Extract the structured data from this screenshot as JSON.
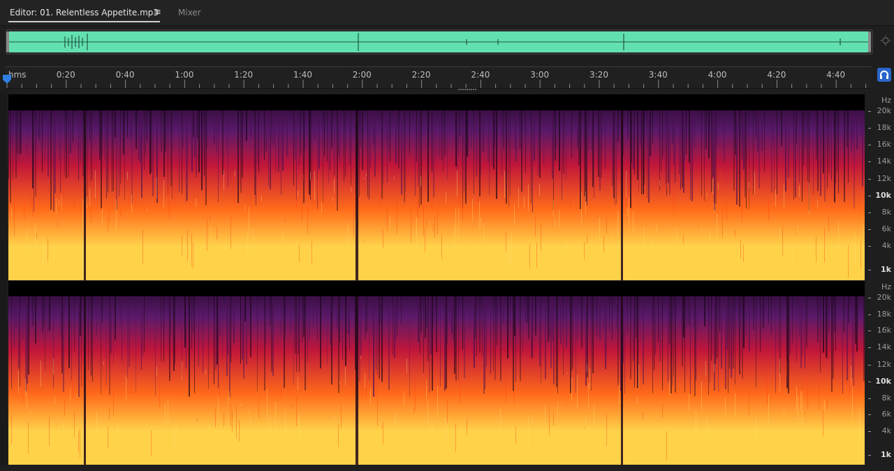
{
  "tabs": {
    "editor_label": "Editor: 01. Relentless Appetite.mp3",
    "menu_glyph": "≡",
    "mixer_label": "Mixer"
  },
  "ruler": {
    "format": "hms",
    "ticks": [
      "0:20",
      "0:40",
      "1:00",
      "1:20",
      "1:40",
      "2:00",
      "2:20",
      "2:40",
      "3:00",
      "3:20",
      "3:40",
      "4:00",
      "4:20",
      "4:40"
    ]
  },
  "frequency_axis": {
    "unit": "Hz",
    "labels": [
      "20k",
      "18k",
      "16k",
      "14k",
      "12k",
      "10k",
      "8k",
      "6k",
      "4k",
      "1k"
    ],
    "emphasized": [
      "10k",
      "1k"
    ]
  },
  "icons": {
    "zoom": "zoom-navigator-icon",
    "headphones": "headphones-icon",
    "playhead": "playhead-marker-icon"
  },
  "colors": {
    "overview_wave": "#63e0b0",
    "spectrum_low": "#ffd24a",
    "spectrum_mid": "#ff6a1a",
    "spectrum_high": "#c0163a",
    "spectrum_top": "#5a1a6a",
    "accent": "#2a66c9"
  }
}
